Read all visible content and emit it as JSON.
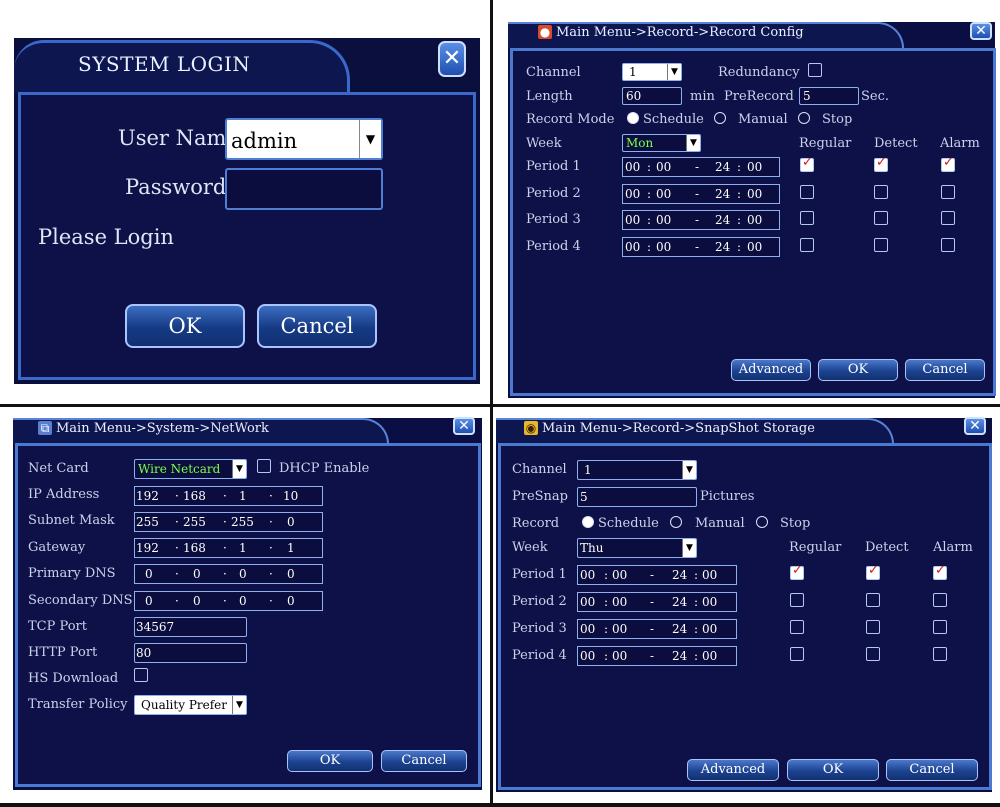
{
  "login": {
    "title": "SYSTEM LOGIN",
    "user_label": "User Name",
    "user_value": "admin",
    "password_label": "Password",
    "password_value": "",
    "status": "Please Login",
    "ok": "OK",
    "cancel": "Cancel",
    "close_icon": "close-icon"
  },
  "record_config": {
    "title": "Main Menu->Record->Record Config",
    "channel_label": "Channel",
    "channel_value": "1",
    "redundancy_label": "Redundancy",
    "length_label": "Length",
    "length_value": "60",
    "length_unit": "min",
    "prerecord_label": "PreRecord",
    "prerecord_value": "5",
    "prerecord_unit": "Sec.",
    "mode_label": "Record Mode",
    "modes": [
      "Schedule",
      "Manual",
      "Stop"
    ],
    "week_label": "Week",
    "week_value": "Mon",
    "col_regular": "Regular",
    "col_detect": "Detect",
    "col_alarm": "Alarm",
    "periods": [
      {
        "label": "Period 1",
        "start_h": "00",
        "start_m": "00",
        "end_h": "24",
        "end_m": "00"
      },
      {
        "label": "Period 2",
        "start_h": "00",
        "start_m": "00",
        "end_h": "24",
        "end_m": "00"
      },
      {
        "label": "Period 3",
        "start_h": "00",
        "start_m": "00",
        "end_h": "24",
        "end_m": "00"
      },
      {
        "label": "Period 4",
        "start_h": "00",
        "start_m": "00",
        "end_h": "24",
        "end_m": "00"
      }
    ],
    "advanced": "Advanced",
    "ok": "OK",
    "cancel": "Cancel"
  },
  "network": {
    "title": "Main Menu->System->NetWork",
    "netcard_label": "Net Card",
    "netcard_value": "Wire Netcard",
    "dhcp_label": "DHCP Enable",
    "ip_label": "IP Address",
    "ip": [
      "192",
      "168",
      "1",
      "10"
    ],
    "mask_label": "Subnet Mask",
    "mask": [
      "255",
      "255",
      "255",
      "0"
    ],
    "gateway_label": "Gateway",
    "gateway": [
      "192",
      "168",
      "1",
      "1"
    ],
    "dns1_label": "Primary DNS",
    "dns1": [
      "0",
      "0",
      "0",
      "0"
    ],
    "dns2_label": "Secondary DNS",
    "dns2": [
      "0",
      "0",
      "0",
      "0"
    ],
    "tcp_label": "TCP Port",
    "tcp_value": "34567",
    "http_label": "HTTP Port",
    "http_value": "80",
    "hs_label": "HS Download",
    "policy_label": "Transfer Policy",
    "policy_value": "Quality Prefer",
    "ok": "OK",
    "cancel": "Cancel"
  },
  "snapshot": {
    "title": "Main Menu->Record->SnapShot Storage",
    "channel_label": "Channel",
    "channel_value": "1",
    "presnap_label": "PreSnap",
    "presnap_value": "5",
    "presnap_unit": "Pictures",
    "record_label": "Record",
    "modes": [
      "Schedule",
      "Manual",
      "Stop"
    ],
    "week_label": "Week",
    "week_value": "Thu",
    "col_regular": "Regular",
    "col_detect": "Detect",
    "col_alarm": "Alarm",
    "periods": [
      {
        "label": "Period 1",
        "start_h": "00",
        "start_m": "00",
        "end_h": "24",
        "end_m": "00"
      },
      {
        "label": "Period 2",
        "start_h": "00",
        "start_m": "00",
        "end_h": "24",
        "end_m": "00"
      },
      {
        "label": "Period 3",
        "start_h": "00",
        "start_m": "00",
        "end_h": "24",
        "end_m": "00"
      },
      {
        "label": "Period 4",
        "start_h": "00",
        "start_m": "00",
        "end_h": "24",
        "end_m": "00"
      }
    ],
    "advanced": "Advanced",
    "ok": "OK",
    "cancel": "Cancel"
  },
  "colors": {
    "panel": "#0d1148",
    "border": "#4a79cf",
    "highlight": "#7cff4a",
    "check": "#d21919"
  }
}
